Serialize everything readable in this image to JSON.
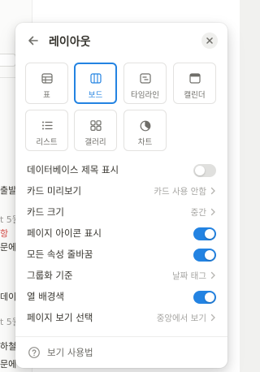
{
  "background": {
    "fragments": [
      "출발",
      "t 5월",
      "항 ",
      "문에",
      "데이",
      "t 5월",
      "하철",
      "문에"
    ]
  },
  "popup": {
    "title": "레이아웃",
    "back_icon": "arrow-left-icon",
    "close_icon": "close-icon",
    "layouts": [
      {
        "label": "표",
        "icon": "table-icon",
        "selected": false
      },
      {
        "label": "보드",
        "icon": "board-icon",
        "selected": true
      },
      {
        "label": "타임라인",
        "icon": "timeline-icon",
        "selected": false
      },
      {
        "label": "캘린더",
        "icon": "calendar-icon",
        "selected": false
      },
      {
        "label": "리스트",
        "icon": "list-icon",
        "selected": false
      },
      {
        "label": "갤러리",
        "icon": "gallery-icon",
        "selected": false
      },
      {
        "label": "차트",
        "icon": "chart-icon",
        "selected": false
      }
    ],
    "settings": [
      {
        "label": "데이터베이스 제목 표시",
        "type": "toggle",
        "on": false
      },
      {
        "label": "카드 미리보기",
        "type": "select",
        "value": "카드 사용 안함"
      },
      {
        "label": "카드 크기",
        "type": "select",
        "value": "중간"
      },
      {
        "label": "페이지 아이콘 표시",
        "type": "toggle",
        "on": true
      },
      {
        "label": "모든 속성 줄바꿈",
        "type": "toggle",
        "on": true
      },
      {
        "label": "그룹화 기준",
        "type": "select",
        "value": "날짜 태그"
      },
      {
        "label": "열 배경색",
        "type": "toggle",
        "on": true
      },
      {
        "label": "페이지 보기 선택",
        "type": "select",
        "value": "중앙에서 보기"
      }
    ],
    "help_label": "보기 사용법",
    "accent_color": "#2383e2"
  }
}
